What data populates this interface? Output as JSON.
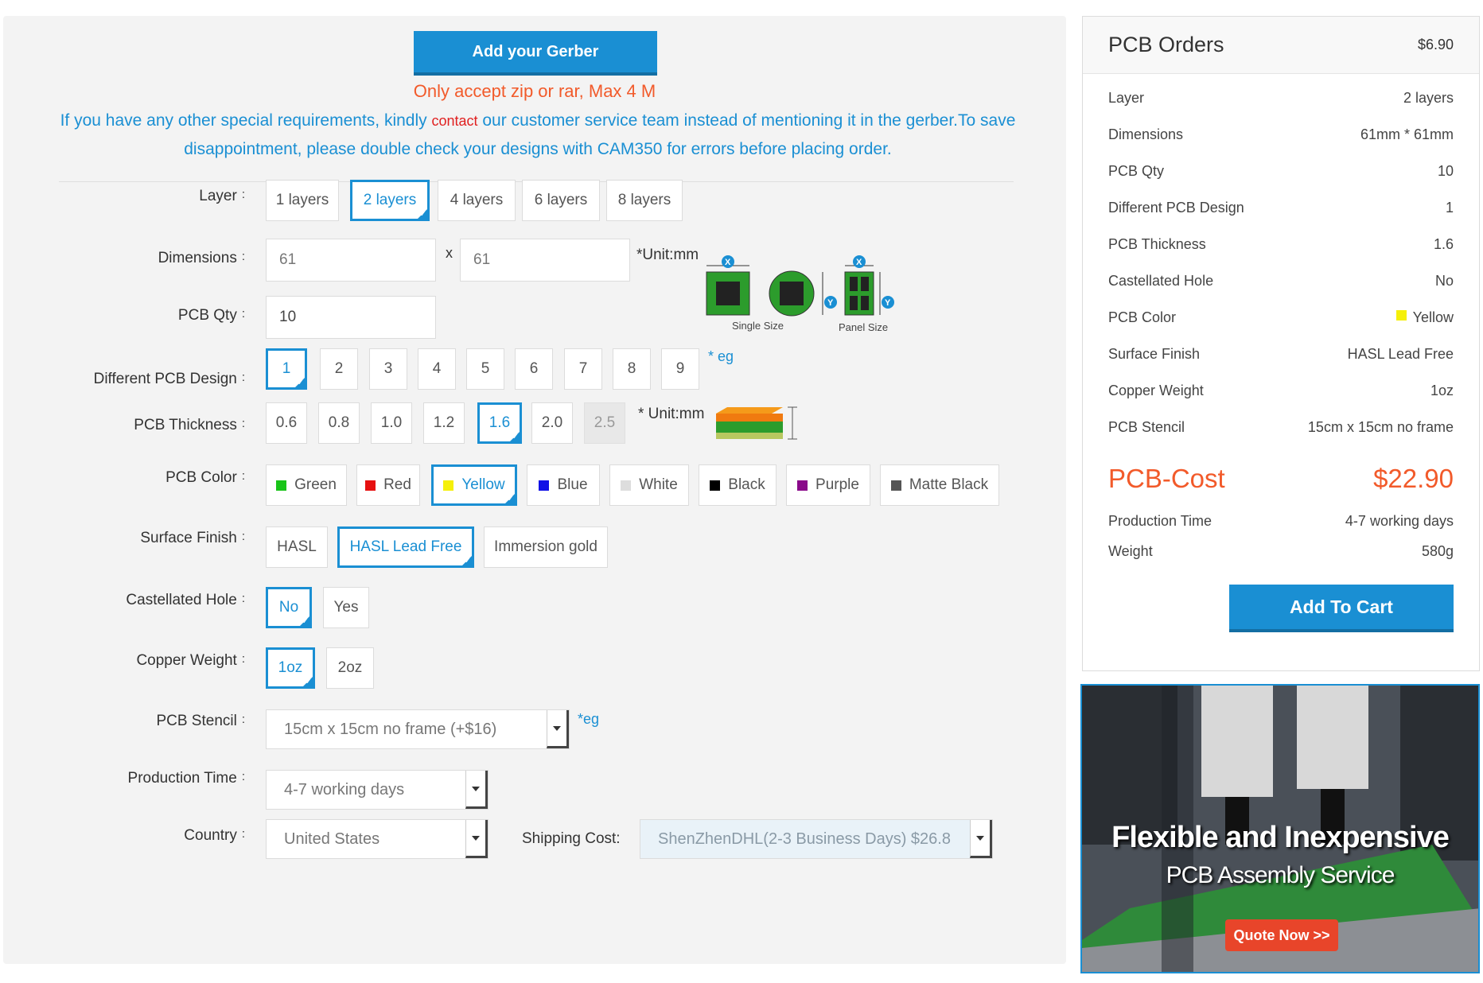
{
  "upload": {
    "button_label": "Add your Gerber",
    "accept_note": "Only accept zip or rar, Max 4 M",
    "req_part1": "If you have any other special requirements, kindly ",
    "req_contact": "contact",
    "req_part2": " our customer service team instead of mentioning it in the gerber.To save disappointment, please double check your designs with CAM350 for errors before placing order."
  },
  "form": {
    "colon": ":",
    "layer": {
      "label": "Layer",
      "options": [
        "1 layers",
        "2 layers",
        "4 layers",
        "6 layers",
        "8 layers"
      ],
      "selected": "2 layers"
    },
    "dimensions": {
      "label": "Dimensions",
      "x_value": "61",
      "y_value": "61",
      "separator": "x",
      "unit": "*Unit:mm",
      "single_size": "Single Size",
      "panel_size": "Panel Size",
      "x_badge": "X",
      "y_badge": "Y"
    },
    "pcb_qty": {
      "label": "PCB Qty",
      "value": "10"
    },
    "different_design": {
      "label": "Different PCB Design",
      "options": [
        "1",
        "2",
        "3",
        "4",
        "5",
        "6",
        "7",
        "8",
        "9"
      ],
      "selected": "1",
      "eg": "* eg"
    },
    "thickness": {
      "label": "PCB Thickness",
      "options": [
        "0.6",
        "0.8",
        "1.0",
        "1.2",
        "1.6",
        "2.0",
        "2.5"
      ],
      "selected": "1.6",
      "disabled": "2.5",
      "unit": "* Unit:mm"
    },
    "color": {
      "label": "PCB Color",
      "options": [
        {
          "name": "Green",
          "hex": "#19c419"
        },
        {
          "name": "Red",
          "hex": "#e61010"
        },
        {
          "name": "Yellow",
          "hex": "#f5f00a"
        },
        {
          "name": "Blue",
          "hex": "#1010e6"
        },
        {
          "name": "White",
          "hex": "#dddddd"
        },
        {
          "name": "Black",
          "hex": "#000000"
        },
        {
          "name": "Purple",
          "hex": "#8a0a8a"
        },
        {
          "name": "Matte Black",
          "hex": "#555555"
        }
      ],
      "selected": "Yellow"
    },
    "surface_finish": {
      "label": "Surface Finish",
      "options": [
        "HASL",
        "HASL Lead Free",
        "Immersion gold"
      ],
      "selected": "HASL Lead Free"
    },
    "castellated_hole": {
      "label": "Castellated Hole",
      "options": [
        "No",
        "Yes"
      ],
      "selected": "No"
    },
    "copper_weight": {
      "label": "Copper Weight",
      "options": [
        "1oz",
        "2oz"
      ],
      "selected": "1oz"
    },
    "stencil": {
      "label": "PCB Stencil",
      "value": "15cm x 15cm no frame (+$16)",
      "eg": "*eg"
    },
    "production_time": {
      "label": "Production Time",
      "value": "4-7 working days"
    },
    "country": {
      "label": "Country",
      "value": "United States"
    },
    "shipping": {
      "label": "Shipping Cost:",
      "value": "ShenZhenDHL(2-3 Business Days) $26.8"
    }
  },
  "summary": {
    "title": "PCB Orders",
    "price": "$6.90",
    "rows": [
      {
        "label": "Layer",
        "value": "2 layers"
      },
      {
        "label": "Dimensions",
        "value": "61mm * 61mm"
      },
      {
        "label": "PCB Qty",
        "value": "10"
      },
      {
        "label": "Different PCB Design",
        "value": "1"
      },
      {
        "label": "PCB Thickness",
        "value": "1.6"
      },
      {
        "label": "Castellated Hole",
        "value": "No"
      },
      {
        "label": "PCB Color",
        "value": "Yellow"
      },
      {
        "label": "Surface Finish",
        "value": "HASL Lead Free"
      },
      {
        "label": "Copper Weight",
        "value": "1oz"
      },
      {
        "label": "PCB Stencil",
        "value": "15cm x 15cm no frame"
      }
    ],
    "cost_label": "PCB-Cost",
    "cost_value": "$22.90",
    "production_label": "Production Time",
    "production_value": "4-7 working days",
    "weight_label": "Weight",
    "weight_value": "580g",
    "cart_label": "Add To Cart"
  },
  "banner": {
    "title": "Flexible and Inexpensive",
    "subtitle": "PCB Assembly Service",
    "cta": "Quote Now >>"
  },
  "colors": {
    "accent": "#1a8fd3",
    "cost": "#f25a2a",
    "yellow_swatch": "#f5f00a"
  }
}
